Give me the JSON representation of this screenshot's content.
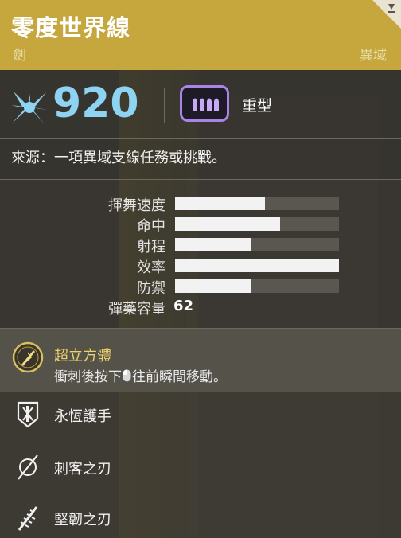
{
  "header": {
    "title": "零度世界線",
    "subtype": "劍",
    "rarity": "異域",
    "accent_color": "#c6a73d"
  },
  "power": {
    "element_icon": "arc-icon",
    "value": "920",
    "value_color": "#8fd3f2",
    "ammo_icon": "heavy-ammo-icon",
    "ammo_color": "#a884e6",
    "ammo_label": "重型"
  },
  "source": "來源：一項異域支線任務或挑戰。",
  "stats": [
    {
      "label": "揮舞速度",
      "fill": 0.55
    },
    {
      "label": "命中",
      "fill": 0.64
    },
    {
      "label": "射程",
      "fill": 0.46
    },
    {
      "label": "效率",
      "fill": 1.0
    },
    {
      "label": "防禦",
      "fill": 0.46
    },
    {
      "label": "彈藥容量",
      "value": "62"
    }
  ],
  "exotic_perk": {
    "icon": "exotic-perk-icon",
    "title": "超立方體",
    "desc_before": "衝刺後按下",
    "desc_icon": "mouse-icon",
    "desc_after": "往前瞬間移動。"
  },
  "perks": [
    {
      "icon": "guard-shield-icon",
      "label": "永恆護手"
    },
    {
      "icon": "blade-slash-icon",
      "label": "刺客之刃"
    },
    {
      "icon": "jagged-blade-icon",
      "label": "堅韌之刃"
    }
  ]
}
